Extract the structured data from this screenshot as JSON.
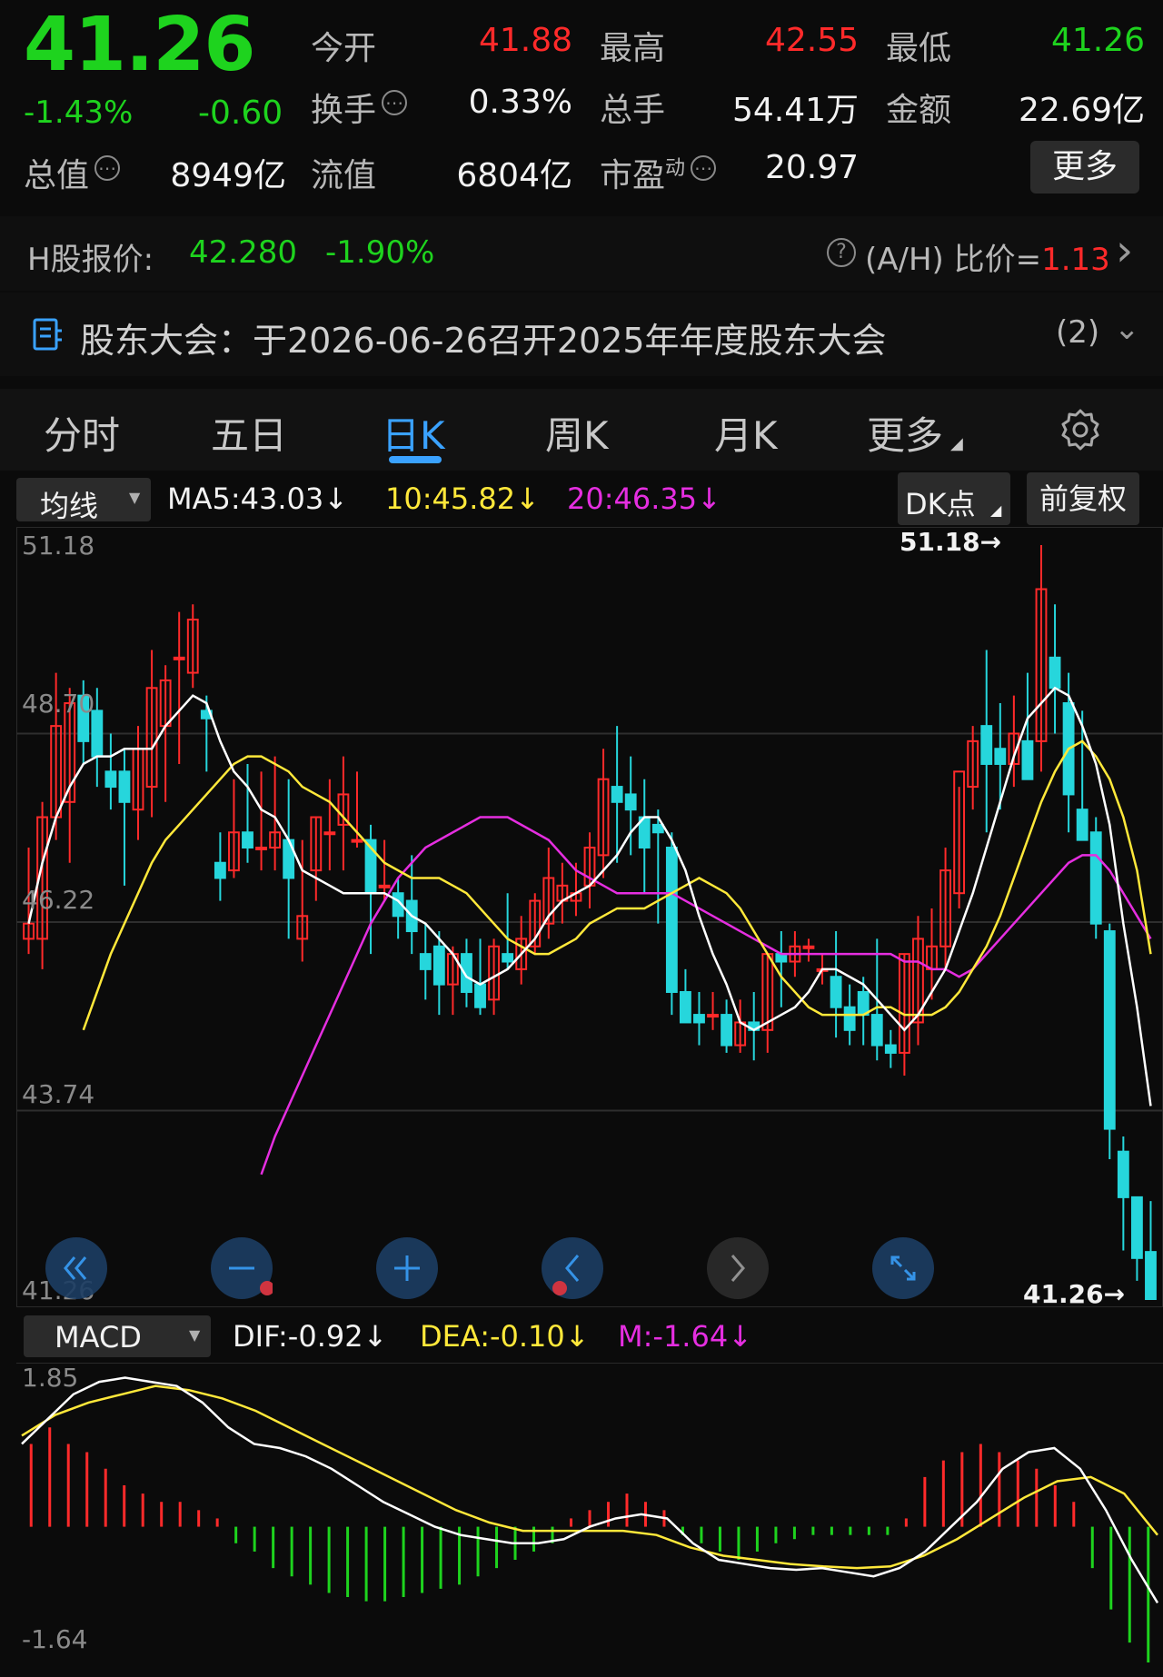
{
  "quote": {
    "price": "41.26",
    "change_pct": "-1.43%",
    "change": "-0.60",
    "open_label": "今开",
    "open": "41.88",
    "high_label": "最高",
    "high": "42.55",
    "low_label": "最低",
    "low": "41.26",
    "turnover_label": "换手",
    "turnover": "0.33%",
    "volume_label": "总手",
    "volume": "54.41万",
    "amount_label": "金额",
    "amount": "22.69亿",
    "mktcap_label": "总值",
    "mktcap": "8949亿",
    "float_label": "流值",
    "float": "6804亿",
    "pe_label": "市盈",
    "pe_sup": "动",
    "pe": "20.97",
    "more_label": "更多",
    "help_glyph": "⋯"
  },
  "hshare": {
    "label": "H股报价:",
    "price": "42.280",
    "change_pct": "-1.90%",
    "ratio_label": "(A/H) 比价=",
    "ratio": "1.13",
    "help_glyph": "?",
    "arrow": "›"
  },
  "notice": {
    "text": "股东大会：于2026-06-26召开2025年年度股东大会",
    "count": "(2)",
    "chevron": "⌄"
  },
  "tabs": [
    {
      "label": "分时"
    },
    {
      "label": "五日"
    },
    {
      "label": "日K"
    },
    {
      "label": "周K"
    },
    {
      "label": "月K"
    },
    {
      "label": "更多"
    }
  ],
  "indicators": {
    "ma_selector": "均线",
    "ma5": "MA5:43.03↓",
    "ma10": "10:45.82↓",
    "ma20": "20:46.35↓",
    "dk_button": "DK点",
    "adjust_button": "前复权",
    "macd_selector": "MACD",
    "dif": "DIF:-0.92↓",
    "dea": "DEA:-0.10↓",
    "m": "M:-1.64↓"
  },
  "axis": {
    "k_top": "51.18",
    "k_l2": "48.70",
    "k_l3": "46.22",
    "k_l4": "43.74",
    "k_bottom": "41.26",
    "macd_top": "1.85",
    "macd_bottom": "-1.64",
    "max_marker": "51.18→",
    "min_marker": "41.26→"
  },
  "colors": {
    "up": "#ff2a2a",
    "down": "#1ed31e",
    "candle_down": "#26d6dc",
    "ma5": "#ffffff",
    "ma10": "#ffe83a",
    "ma20": "#e52ee0",
    "accent": "#3aa2ff"
  },
  "icons": [
    "double-left-icon",
    "zoom-out-icon",
    "zoom-in-icon",
    "left-icon",
    "right-icon",
    "expand-icon",
    "gear-icon",
    "document-icon"
  ],
  "chart_data": {
    "type": "candlestick",
    "y_range": [
      41.26,
      51.18
    ],
    "candles": [
      {
        "o": 46.0,
        "h": 47.2,
        "l": 45.8,
        "c": 46.2
      },
      {
        "o": 46.0,
        "h": 47.8,
        "l": 45.6,
        "c": 47.6
      },
      {
        "o": 47.6,
        "h": 49.5,
        "l": 47.3,
        "c": 48.8
      },
      {
        "o": 47.8,
        "h": 49.3,
        "l": 47.0,
        "c": 49.1
      },
      {
        "o": 49.2,
        "h": 49.4,
        "l": 48.3,
        "c": 48.6
      },
      {
        "o": 49.0,
        "h": 49.3,
        "l": 48.0,
        "c": 48.4
      },
      {
        "o": 48.2,
        "h": 48.7,
        "l": 47.7,
        "c": 48.0
      },
      {
        "o": 48.2,
        "h": 48.5,
        "l": 46.7,
        "c": 47.8
      },
      {
        "o": 47.7,
        "h": 48.8,
        "l": 47.3,
        "c": 48.5
      },
      {
        "o": 48.0,
        "h": 49.8,
        "l": 47.6,
        "c": 49.3
      },
      {
        "o": 48.8,
        "h": 49.6,
        "l": 47.8,
        "c": 49.4
      },
      {
        "o": 49.7,
        "h": 50.3,
        "l": 48.3,
        "c": 49.7
      },
      {
        "o": 49.5,
        "h": 50.4,
        "l": 49.3,
        "c": 50.2
      },
      {
        "o": 49.0,
        "h": 49.2,
        "l": 48.2,
        "c": 48.9
      },
      {
        "o": 47.0,
        "h": 47.4,
        "l": 46.5,
        "c": 46.8
      },
      {
        "o": 46.9,
        "h": 48.1,
        "l": 46.8,
        "c": 47.4
      },
      {
        "o": 47.4,
        "h": 48.3,
        "l": 47.0,
        "c": 47.2
      },
      {
        "o": 47.2,
        "h": 48.2,
        "l": 46.9,
        "c": 47.2
      },
      {
        "o": 47.2,
        "h": 48.4,
        "l": 46.9,
        "c": 47.4
      },
      {
        "o": 47.3,
        "h": 48.1,
        "l": 46.0,
        "c": 46.8
      },
      {
        "o": 46.0,
        "h": 47.3,
        "l": 45.7,
        "c": 46.3
      },
      {
        "o": 46.9,
        "h": 47.6,
        "l": 46.5,
        "c": 47.6
      },
      {
        "o": 47.4,
        "h": 48.1,
        "l": 46.9,
        "c": 47.4
      },
      {
        "o": 47.5,
        "h": 48.4,
        "l": 46.9,
        "c": 47.9
      },
      {
        "o": 47.3,
        "h": 48.2,
        "l": 47.2,
        "c": 47.3
      },
      {
        "o": 47.3,
        "h": 47.5,
        "l": 45.8,
        "c": 46.6
      },
      {
        "o": 46.7,
        "h": 47.3,
        "l": 46.5,
        "c": 46.7
      },
      {
        "o": 46.6,
        "h": 46.8,
        "l": 46.0,
        "c": 46.3
      },
      {
        "o": 46.5,
        "h": 47.1,
        "l": 45.8,
        "c": 46.1
      },
      {
        "o": 45.8,
        "h": 46.2,
        "l": 45.2,
        "c": 45.6
      },
      {
        "o": 45.9,
        "h": 46.1,
        "l": 45.0,
        "c": 45.4
      },
      {
        "o": 45.4,
        "h": 45.9,
        "l": 45.0,
        "c": 45.8
      },
      {
        "o": 45.8,
        "h": 46.0,
        "l": 45.1,
        "c": 45.3
      },
      {
        "o": 45.4,
        "h": 46.0,
        "l": 45.0,
        "c": 45.1
      },
      {
        "o": 45.2,
        "h": 46.0,
        "l": 45.0,
        "c": 45.9
      },
      {
        "o": 45.8,
        "h": 46.6,
        "l": 45.6,
        "c": 45.7
      },
      {
        "o": 45.6,
        "h": 46.3,
        "l": 45.4,
        "c": 46.0
      },
      {
        "o": 45.9,
        "h": 46.6,
        "l": 45.8,
        "c": 46.5
      },
      {
        "o": 46.2,
        "h": 47.2,
        "l": 46.0,
        "c": 46.8
      },
      {
        "o": 46.5,
        "h": 47.0,
        "l": 46.2,
        "c": 46.7
      },
      {
        "o": 46.5,
        "h": 47.0,
        "l": 46.3,
        "c": 46.6
      },
      {
        "o": 46.7,
        "h": 47.4,
        "l": 46.4,
        "c": 47.2
      },
      {
        "o": 47.1,
        "h": 48.5,
        "l": 46.8,
        "c": 48.1
      },
      {
        "o": 48.0,
        "h": 48.8,
        "l": 47.0,
        "c": 47.8
      },
      {
        "o": 47.9,
        "h": 48.4,
        "l": 47.1,
        "c": 47.7
      },
      {
        "o": 47.6,
        "h": 48.1,
        "l": 46.6,
        "c": 47.2
      },
      {
        "o": 47.5,
        "h": 47.7,
        "l": 46.2,
        "c": 47.4
      },
      {
        "o": 47.2,
        "h": 47.4,
        "l": 45.0,
        "c": 45.3
      },
      {
        "o": 45.3,
        "h": 45.6,
        "l": 44.9,
        "c": 44.9
      },
      {
        "o": 45.0,
        "h": 45.3,
        "l": 44.6,
        "c": 44.9
      },
      {
        "o": 45.0,
        "h": 45.3,
        "l": 44.8,
        "c": 45.0
      },
      {
        "o": 45.0,
        "h": 45.2,
        "l": 44.5,
        "c": 44.6
      },
      {
        "o": 44.6,
        "h": 45.2,
        "l": 44.5,
        "c": 44.9
      },
      {
        "o": 44.9,
        "h": 45.3,
        "l": 44.4,
        "c": 44.8
      },
      {
        "o": 44.8,
        "h": 45.8,
        "l": 44.5,
        "c": 45.8
      },
      {
        "o": 45.8,
        "h": 46.1,
        "l": 45.1,
        "c": 45.7
      },
      {
        "o": 45.7,
        "h": 46.1,
        "l": 45.5,
        "c": 45.9
      },
      {
        "o": 45.9,
        "h": 46.0,
        "l": 45.7,
        "c": 45.9
      },
      {
        "o": 45.6,
        "h": 45.8,
        "l": 45.4,
        "c": 45.6
      },
      {
        "o": 45.5,
        "h": 46.1,
        "l": 44.7,
        "c": 45.1
      },
      {
        "o": 45.1,
        "h": 45.4,
        "l": 44.6,
        "c": 44.8
      },
      {
        "o": 45.3,
        "h": 45.5,
        "l": 44.6,
        "c": 45.0
      },
      {
        "o": 45.0,
        "h": 46.0,
        "l": 44.4,
        "c": 44.6
      },
      {
        "o": 44.6,
        "h": 44.8,
        "l": 44.3,
        "c": 44.5
      },
      {
        "o": 44.5,
        "h": 45.8,
        "l": 44.2,
        "c": 45.8
      },
      {
        "o": 44.9,
        "h": 46.3,
        "l": 44.6,
        "c": 46.0
      },
      {
        "o": 45.6,
        "h": 46.4,
        "l": 45.2,
        "c": 45.9
      },
      {
        "o": 45.9,
        "h": 47.2,
        "l": 45.6,
        "c": 46.9
      },
      {
        "o": 46.6,
        "h": 48.0,
        "l": 46.4,
        "c": 48.2
      },
      {
        "o": 48.0,
        "h": 48.8,
        "l": 47.7,
        "c": 48.6
      },
      {
        "o": 48.8,
        "h": 49.8,
        "l": 47.4,
        "c": 48.3
      },
      {
        "o": 48.5,
        "h": 49.1,
        "l": 47.7,
        "c": 48.3
      },
      {
        "o": 48.3,
        "h": 49.2,
        "l": 48.0,
        "c": 48.7
      },
      {
        "o": 48.6,
        "h": 49.5,
        "l": 48.1,
        "c": 48.1
      },
      {
        "o": 48.6,
        "h": 51.18,
        "l": 48.2,
        "c": 50.6
      },
      {
        "o": 49.7,
        "h": 50.4,
        "l": 48.7,
        "c": 49.3
      },
      {
        "o": 49.1,
        "h": 49.5,
        "l": 47.4,
        "c": 47.9
      },
      {
        "o": 47.7,
        "h": 49.0,
        "l": 47.3,
        "c": 47.3
      },
      {
        "o": 47.4,
        "h": 47.6,
        "l": 46.0,
        "c": 46.2
      },
      {
        "o": 46.1,
        "h": 46.2,
        "l": 43.1,
        "c": 43.5
      },
      {
        "o": 43.2,
        "h": 43.4,
        "l": 41.9,
        "c": 42.6
      },
      {
        "o": 42.6,
        "h": 42.6,
        "l": 41.5,
        "c": 41.8
      },
      {
        "o": 41.88,
        "h": 42.55,
        "l": 41.26,
        "c": 41.26
      }
    ],
    "ma5": [
      46.2,
      47.0,
      47.6,
      48.0,
      48.3,
      48.4,
      48.4,
      48.5,
      48.5,
      48.5,
      48.8,
      49.0,
      49.2,
      49.1,
      48.6,
      48.2,
      48.0,
      47.7,
      47.6,
      47.3,
      46.9,
      46.8,
      46.7,
      46.6,
      46.6,
      46.6,
      46.6,
      46.5,
      46.3,
      46.2,
      46.0,
      45.8,
      45.5,
      45.4,
      45.5,
      45.6,
      45.8,
      46.0,
      46.3,
      46.5,
      46.6,
      46.7,
      46.9,
      47.1,
      47.4,
      47.6,
      47.6,
      47.3,
      46.9,
      46.3,
      45.8,
      45.4,
      44.9,
      44.8,
      44.9,
      45.0,
      45.1,
      45.3,
      45.6,
      45.6,
      45.5,
      45.4,
      45.2,
      45.0,
      44.8,
      45.0,
      45.3,
      45.6,
      46.1,
      46.6,
      47.2,
      47.8,
      48.4,
      48.9,
      49.1,
      49.3,
      49.2,
      48.8,
      48.3,
      47.5,
      46.2,
      45.1,
      43.8
    ],
    "ma10": [
      44.8,
      45.3,
      45.8,
      46.2,
      46.6,
      47.0,
      47.3,
      47.5,
      47.7,
      47.9,
      48.1,
      48.3,
      48.4,
      48.4,
      48.3,
      48.2,
      48.0,
      47.9,
      47.8,
      47.6,
      47.4,
      47.2,
      47.0,
      46.9,
      46.8,
      46.8,
      46.8,
      46.7,
      46.6,
      46.4,
      46.2,
      46.0,
      45.9,
      45.8,
      45.8,
      45.9,
      46.0,
      46.2,
      46.3,
      46.4,
      46.4,
      46.4,
      46.5,
      46.6,
      46.7,
      46.8,
      46.7,
      46.6,
      46.4,
      46.1,
      45.8,
      45.5,
      45.3,
      45.1,
      45.0,
      45.0,
      45.0,
      45.0,
      45.1,
      45.1,
      45.0,
      45.0,
      45.0,
      45.1,
      45.3,
      45.6,
      45.9,
      46.3,
      46.8,
      47.3,
      47.8,
      48.2,
      48.5,
      48.6,
      48.4,
      48.1,
      47.6,
      46.9,
      45.8
    ],
    "ma20": [
      42.9,
      43.4,
      43.8,
      44.2,
      44.6,
      45.0,
      45.4,
      45.8,
      46.2,
      46.5,
      46.8,
      47.0,
      47.2,
      47.3,
      47.4,
      47.5,
      47.6,
      47.6,
      47.6,
      47.5,
      47.4,
      47.3,
      47.1,
      46.9,
      46.8,
      46.7,
      46.6,
      46.6,
      46.6,
      46.6,
      46.6,
      46.5,
      46.4,
      46.3,
      46.2,
      46.1,
      46.0,
      45.9,
      45.8,
      45.8,
      45.8,
      45.8,
      45.8,
      45.8,
      45.8,
      45.8,
      45.8,
      45.7,
      45.7,
      45.6,
      45.6,
      45.5,
      45.6,
      45.8,
      46.0,
      46.2,
      46.4,
      46.6,
      46.8,
      47.0,
      47.1,
      47.1,
      46.9,
      46.6,
      46.3,
      46.0
    ],
    "macd_range": [
      -1.64,
      1.85
    ],
    "dif": [
      1.0,
      1.3,
      1.6,
      1.75,
      1.8,
      1.75,
      1.7,
      1.5,
      1.2,
      1.0,
      0.95,
      0.85,
      0.7,
      0.5,
      0.3,
      0.15,
      0.0,
      -0.1,
      -0.15,
      -0.2,
      -0.2,
      -0.15,
      0.0,
      0.1,
      0.15,
      0.1,
      -0.2,
      -0.4,
      -0.45,
      -0.5,
      -0.52,
      -0.5,
      -0.55,
      -0.6,
      -0.5,
      -0.3,
      0.0,
      0.3,
      0.7,
      0.9,
      0.95,
      0.7,
      0.2,
      -0.4,
      -0.92
    ],
    "dea": [
      1.1,
      1.35,
      1.5,
      1.6,
      1.7,
      1.65,
      1.55,
      1.4,
      1.2,
      1.0,
      0.8,
      0.6,
      0.4,
      0.2,
      0.05,
      -0.05,
      -0.05,
      -0.05,
      -0.05,
      -0.1,
      -0.25,
      -0.35,
      -0.4,
      -0.45,
      -0.48,
      -0.5,
      -0.48,
      -0.35,
      -0.15,
      0.1,
      0.35,
      0.55,
      0.6,
      0.4,
      -0.1
    ],
    "m_hist": [
      1.0,
      1.2,
      1.0,
      0.9,
      0.7,
      0.5,
      0.4,
      0.3,
      0.3,
      0.2,
      0.1,
      -0.2,
      -0.3,
      -0.5,
      -0.6,
      -0.7,
      -0.8,
      -0.85,
      -0.9,
      -0.9,
      -0.85,
      -0.8,
      -0.75,
      -0.7,
      -0.6,
      -0.5,
      -0.4,
      -0.3,
      -0.2,
      0.1,
      0.2,
      0.3,
      0.4,
      0.3,
      0.2,
      -0.1,
      -0.2,
      -0.3,
      -0.4,
      -0.3,
      -0.2,
      -0.15,
      -0.1,
      -0.1,
      -0.1,
      -0.1,
      -0.1,
      0.1,
      0.6,
      0.8,
      0.9,
      1.0,
      0.9,
      0.8,
      0.7,
      0.5,
      0.3,
      -0.5,
      -1.0,
      -1.4,
      -1.64
    ]
  }
}
